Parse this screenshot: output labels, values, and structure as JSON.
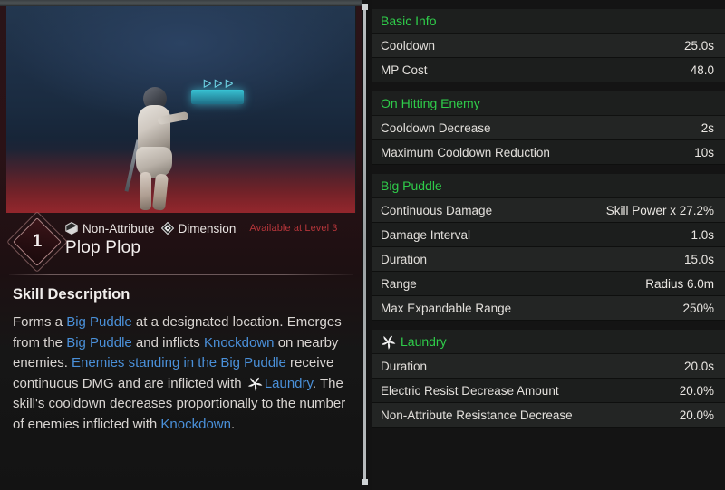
{
  "skill": {
    "level": "1",
    "name": "Plop Plop",
    "attributes": [
      {
        "icon": "non-attribute-icon",
        "label": "Non-Attribute"
      },
      {
        "icon": "dimension-icon",
        "label": "Dimension"
      }
    ],
    "availability": "Available at Level 3",
    "description_title": "Skill Description",
    "description_parts": [
      {
        "t": "Forms a ",
        "k": false
      },
      {
        "t": "Big Puddle",
        "k": true
      },
      {
        "t": " at a designated location. Emerges from the ",
        "k": false
      },
      {
        "t": "Big Puddle",
        "k": true
      },
      {
        "t": " and inflicts ",
        "k": false
      },
      {
        "t": "Knockdown",
        "k": true
      },
      {
        "t": " on nearby enemies. ",
        "k": false
      },
      {
        "t": "Enemies standing in the Big Puddle",
        "k": true
      },
      {
        "t": " receive continuous DMG and are inflicted with ",
        "k": false
      },
      {
        "t": "__ICON__",
        "k": false
      },
      {
        "t": "Laundry",
        "k": true
      },
      {
        "t": ". The skill's cooldown decreases proportionally to the number of enemies inflicted with ",
        "k": false
      },
      {
        "t": "Knockdown",
        "k": true
      },
      {
        "t": ".",
        "k": false
      }
    ]
  },
  "stats": {
    "sections": [
      {
        "title": "Basic Info",
        "icon": null,
        "rows": [
          {
            "label": "Cooldown",
            "value": "25.0s"
          },
          {
            "label": "MP Cost",
            "value": "48.0"
          }
        ]
      },
      {
        "title": "On Hitting Enemy",
        "icon": null,
        "rows": [
          {
            "label": "Cooldown Decrease",
            "value": "2s"
          },
          {
            "label": "Maximum Cooldown Reduction",
            "value": "10s"
          }
        ]
      },
      {
        "title": "Big Puddle",
        "icon": null,
        "rows": [
          {
            "label": "Continuous Damage",
            "value": "Skill Power x 27.2%"
          },
          {
            "label": "Damage Interval",
            "value": "1.0s"
          },
          {
            "label": "Duration",
            "value": "15.0s"
          },
          {
            "label": "Range",
            "value": "Radius 6.0m"
          },
          {
            "label": "Max Expandable Range",
            "value": "250%"
          }
        ]
      },
      {
        "title": "Laundry",
        "icon": "laundry-pinwheel-icon",
        "rows": [
          {
            "label": "Duration",
            "value": "20.0s"
          },
          {
            "label": "Electric Resist Decrease Amount",
            "value": "20.0%"
          },
          {
            "label": "Non-Attribute Resistance Decrease",
            "value": "20.0%"
          }
        ]
      }
    ]
  },
  "colors": {
    "section_green": "#2fcc4a",
    "keyword_blue": "#4a90d9",
    "availability_red": "#b4353a"
  }
}
